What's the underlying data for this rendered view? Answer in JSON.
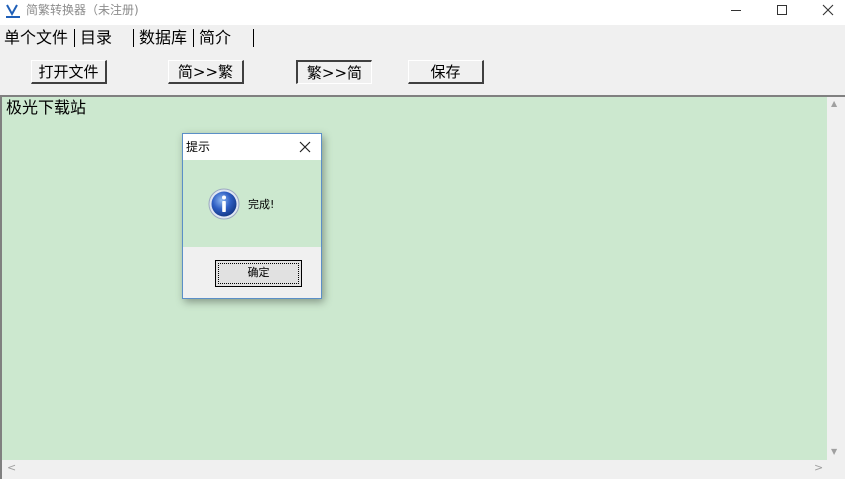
{
  "window": {
    "title": "简繁转换器（未注册)",
    "min_icon": "minimize-icon",
    "max_icon": "maximize-icon",
    "close_icon": "close-icon"
  },
  "tabs": [
    {
      "label": "单个文件"
    },
    {
      "label": "目录"
    },
    {
      "label": "数据库"
    },
    {
      "label": "简介"
    }
  ],
  "toolbar": {
    "open_label": "打开文件",
    "s2t_label": "简>>繁",
    "t2s_label": "繁>>简",
    "save_label": "保存"
  },
  "editor": {
    "content": "极光下载站",
    "background": "#cce8cf"
  },
  "dialog": {
    "title": "提示",
    "message": "完成!",
    "ok_label": "确定",
    "icon": "info-icon"
  },
  "scrollbars": {
    "up": "▲",
    "down": "▼",
    "left": "<",
    "right": ">"
  }
}
